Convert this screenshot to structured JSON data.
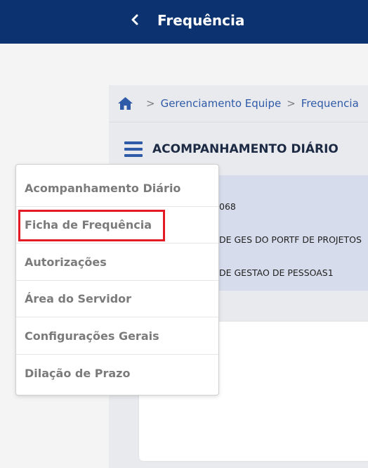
{
  "header": {
    "title": "Frequência"
  },
  "breadcrumb": {
    "items": [
      "Gerenciamento Equipe",
      "Frequencia"
    ],
    "separator": ">"
  },
  "page": {
    "title": "ACOMPANHAMENTO DIÁRIO"
  },
  "info": {
    "lines": [
      "068",
      "DE GES DO PORTF DE PROJETOS",
      "DE GESTAO DE PESSOAS1"
    ]
  },
  "menu": {
    "items": [
      {
        "label": "Acompanhamento Diário"
      },
      {
        "label": "Ficha de Frequência",
        "highlighted": true
      },
      {
        "label": "Autorizações"
      },
      {
        "label": "Área do Servidor"
      },
      {
        "label": "Configurações Gerais"
      },
      {
        "label": "Dilação de Prazo"
      }
    ]
  },
  "colors": {
    "header_bg": "#0d3270",
    "link": "#2e5aa8",
    "highlight_border": "#e21b24",
    "info_bg": "#d6dceb"
  },
  "icons": {
    "back": "chevron-left-icon",
    "home": "home-icon",
    "menu": "hamburger-icon"
  }
}
